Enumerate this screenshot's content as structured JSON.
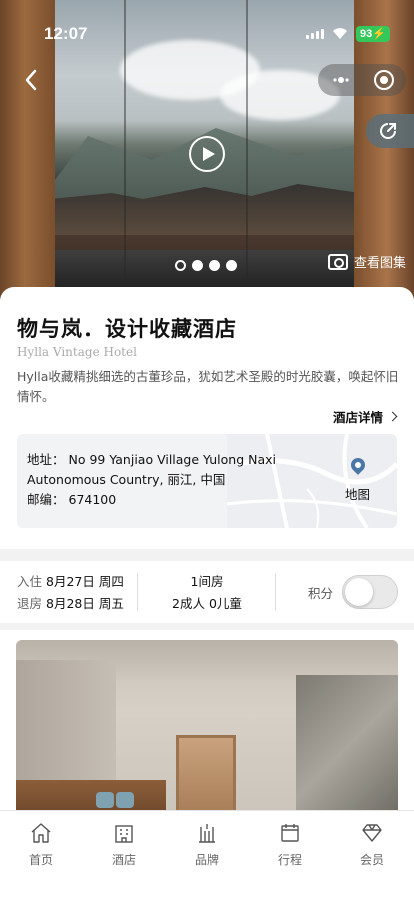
{
  "status_bar": {
    "time": "12:07",
    "battery": "93"
  },
  "hero": {
    "gallery_label": "查看图集",
    "carousel_dots": 4,
    "active_dot": 0
  },
  "hotel": {
    "name": "物与岚．设计收藏酒店",
    "english_name": "Hylla Vintage Hotel",
    "description": "Hylla收藏精挑细选的古董珍品，犹如艺术圣殿的时光胶囊，唤起怀旧情怀。",
    "details_link": "酒店详情",
    "address_label": "地址：",
    "address_value": "No 99 Yanjiao Village Yulong Naxi Autonomous Country, 丽江, 中国",
    "postcode_label": "邮编：",
    "postcode_value": "674100",
    "map_label": "地图"
  },
  "booking": {
    "checkin_label": "入住",
    "checkin_date": "8月27日 周四",
    "checkout_label": "退房",
    "checkout_date": "8月28日 周五",
    "rooms": "1间房",
    "guests": "2成人 0儿童",
    "points_label": "积分",
    "points_enabled": false
  },
  "tabbar": {
    "items": [
      {
        "label": "首页",
        "icon": "home-icon"
      },
      {
        "label": "酒店",
        "icon": "building-icon"
      },
      {
        "label": "品牌",
        "icon": "brand-icon"
      },
      {
        "label": "行程",
        "icon": "calendar-icon"
      },
      {
        "label": "会员",
        "icon": "diamond-icon"
      }
    ]
  }
}
